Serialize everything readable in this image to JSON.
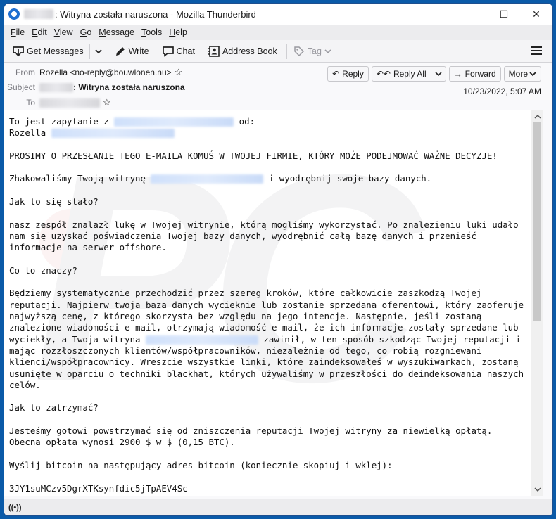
{
  "window": {
    "title_suffix": ": Witryna została naruszona - Mozilla Thunderbird",
    "controls": {
      "minimize": "–",
      "maximize": "☐",
      "close": "✕"
    }
  },
  "menubar": {
    "items": [
      {
        "accel": "F",
        "rest": "ile"
      },
      {
        "accel": "E",
        "rest": "dit"
      },
      {
        "accel": "V",
        "rest": "iew"
      },
      {
        "accel": "G",
        "rest": "o"
      },
      {
        "accel": "M",
        "rest": "essage"
      },
      {
        "accel": "T",
        "rest": "ools"
      },
      {
        "accel": "H",
        "rest": "elp"
      }
    ]
  },
  "toolbar": {
    "get_messages": "Get Messages",
    "write": "Write",
    "chat": "Chat",
    "address_book": "Address Book",
    "tag": "Tag",
    "icons": {
      "get_messages": "inbox-download-icon",
      "write": "pencil-icon",
      "chat": "chat-bubble-icon",
      "address_book": "contact-card-icon",
      "tag": "tag-icon",
      "menu": "hamburger-menu-icon"
    }
  },
  "header": {
    "from_label": "From",
    "from_value": "Rozella <no-reply@bouwlonen.nu>",
    "subject_label": "Subject",
    "subject_value": ": Witryna została naruszona",
    "to_label": "To",
    "date": "10/23/2022, 5:07 AM",
    "buttons": {
      "reply": "Reply",
      "reply_all": "Reply All",
      "forward": "Forward",
      "more": "More"
    }
  },
  "body": {
    "line1_prefix": "To jest zapytanie z ",
    "line1_suffix": " od:",
    "line2_prefix": "Rozella ",
    "p_request": "PROSIMY O PRZESŁANIE TEGO E-MAILA KOMUŚ W TWOJEJ FIRMIE, KTÓRY MOŻE PODEJMOWAĆ WAŻNE DECYZJE!",
    "p_hacked_prefix": "Zhakowaliśmy Twoją witrynę ",
    "p_hacked_suffix": " i wyodrębnij swoje bazy danych.",
    "h_how": "Jak to się stało?",
    "p_how": "nasz zespół znalazł lukę w Twojej witrynie, którą mogliśmy wykorzystać. Po znalezieniu luki udało\nnam się uzyskać poświadczenia Twojej bazy danych, wyodrębnić całą bazę danych i przenieść\ninformacje na serwer offshore.",
    "h_means": "Co to znaczy?",
    "p_means_1": "Będziemy systematycznie przechodzić przez szereg kroków, które całkowicie zaszkodzą Twojej\nreputacji. Najpierw twoja baza danych wycieknie lub zostanie sprzedana oferentowi, który zaoferuje\nnajwyższą cenę, z którego skorzysta bez względu na jego intencje. Następnie, jeśli zostaną\nznalezione wiadomości e-mail, otrzymają wiadomość e-mail, że ich informacje zostały sprzedane lub\nwyciekły, a Twoja witryna ",
    "p_means_2": " zawinił, w ten sposób szkodząc Twojej reputacji i\nmając rozzłoszczonych klientów/współpracowników, niezależnie od tego, co robią rozgniewani\nklienci/współpracownicy. Wreszcie wszystkie linki, które zaindeksowałeś w wyszukiwarkach, zostaną\nusunięte w oparciu o techniki blackhat, których używaliśmy w przeszłości do deindeksowania naszych\ncelów.",
    "h_stop": "Jak to zatrzymać?",
    "p_stop": "Jesteśmy gotowi powstrzymać się od zniszczenia reputacji Twojej witryny za niewielką opłatą.\nObecna opłata wynosi 2900 $ w $ (0,15 BTC).",
    "p_send": "Wyślij bitcoin na następujący adres bitcoin (koniecznie skopiuj i wklej):",
    "btc_address": "3JY1suMCzv5DgrXTKsynfdic5jTpAEV4Sc"
  },
  "scrollbar": {
    "position_fraction": 0.0,
    "visible_fraction": 0.55
  },
  "statusbar": {
    "icon": "online-status-icon",
    "glyph": "((•))"
  }
}
